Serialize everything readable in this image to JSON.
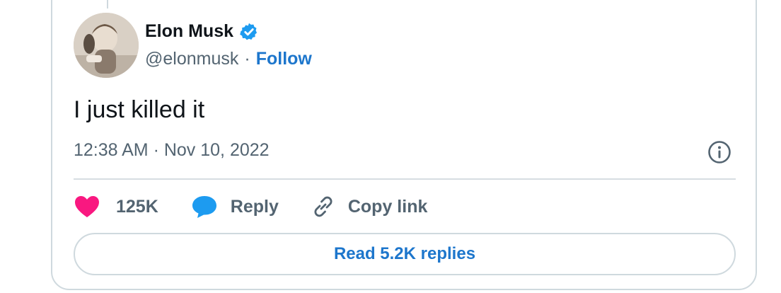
{
  "author": {
    "name": "Elon Musk",
    "handle": "@elonmusk",
    "separator": "·",
    "follow_label": "Follow",
    "verified_color": "#1d9bf0"
  },
  "tweet": {
    "text": "I just killed it",
    "timestamp": "12:38 AM · Nov 10, 2022"
  },
  "actions": {
    "like_count": "125K",
    "reply_label": "Reply",
    "copy_link_label": "Copy link"
  },
  "replies_button": {
    "label": "Read 5.2K replies"
  },
  "colors": {
    "accent": "#1d76cc",
    "like": "#f91880",
    "reply": "#1d9bf0",
    "muted": "#536471",
    "border": "#cfd9de"
  },
  "icons": {
    "like": "heart-icon",
    "reply": "speech-bubble-icon",
    "copy": "link-icon",
    "info": "info-icon",
    "verified": "verified-badge-icon"
  }
}
